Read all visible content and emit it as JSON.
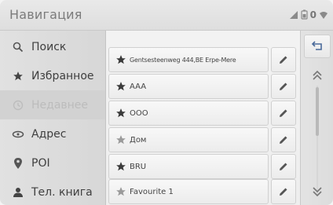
{
  "header": {
    "title": "Навигация",
    "status": {
      "signal_icon": "signal-icon",
      "battery_icon": "battery-icon",
      "count": "0",
      "wifi_icon": "wifi-icon"
    }
  },
  "sidebar": {
    "items": [
      {
        "label": "Поиск",
        "icon": "search-icon",
        "active": false
      },
      {
        "label": "Избранное",
        "icon": "star-icon",
        "active": false
      },
      {
        "label": "Недавнее",
        "icon": "clock-icon",
        "active": true
      },
      {
        "label": "Адрес",
        "icon": "location-icon",
        "active": false
      },
      {
        "label": "POI",
        "icon": "poi-pin-icon",
        "active": false
      },
      {
        "label": "Тел. книга",
        "icon": "contact-icon",
        "active": false
      }
    ]
  },
  "list": {
    "rows": [
      {
        "label": "Gentsesteenweg 444,BE Erpe-Mere",
        "star": "filled"
      },
      {
        "label": "AAA",
        "star": "filled"
      },
      {
        "label": "OOO",
        "star": "filled"
      },
      {
        "label": "Дом",
        "star": "outline"
      },
      {
        "label": "BRU",
        "star": "filled"
      },
      {
        "label": "Favourite 1",
        "star": "outline"
      }
    ]
  },
  "rightcol": {
    "back_icon": "back-arrow-icon",
    "scroll_up_icon": "double-chevron-up-icon",
    "scroll_down_icon": "double-chevron-down-icon"
  },
  "colors": {
    "text": "#3f3f3f",
    "inactive_text": "#bcbcbc",
    "header_bg": "#e0e0e0"
  }
}
